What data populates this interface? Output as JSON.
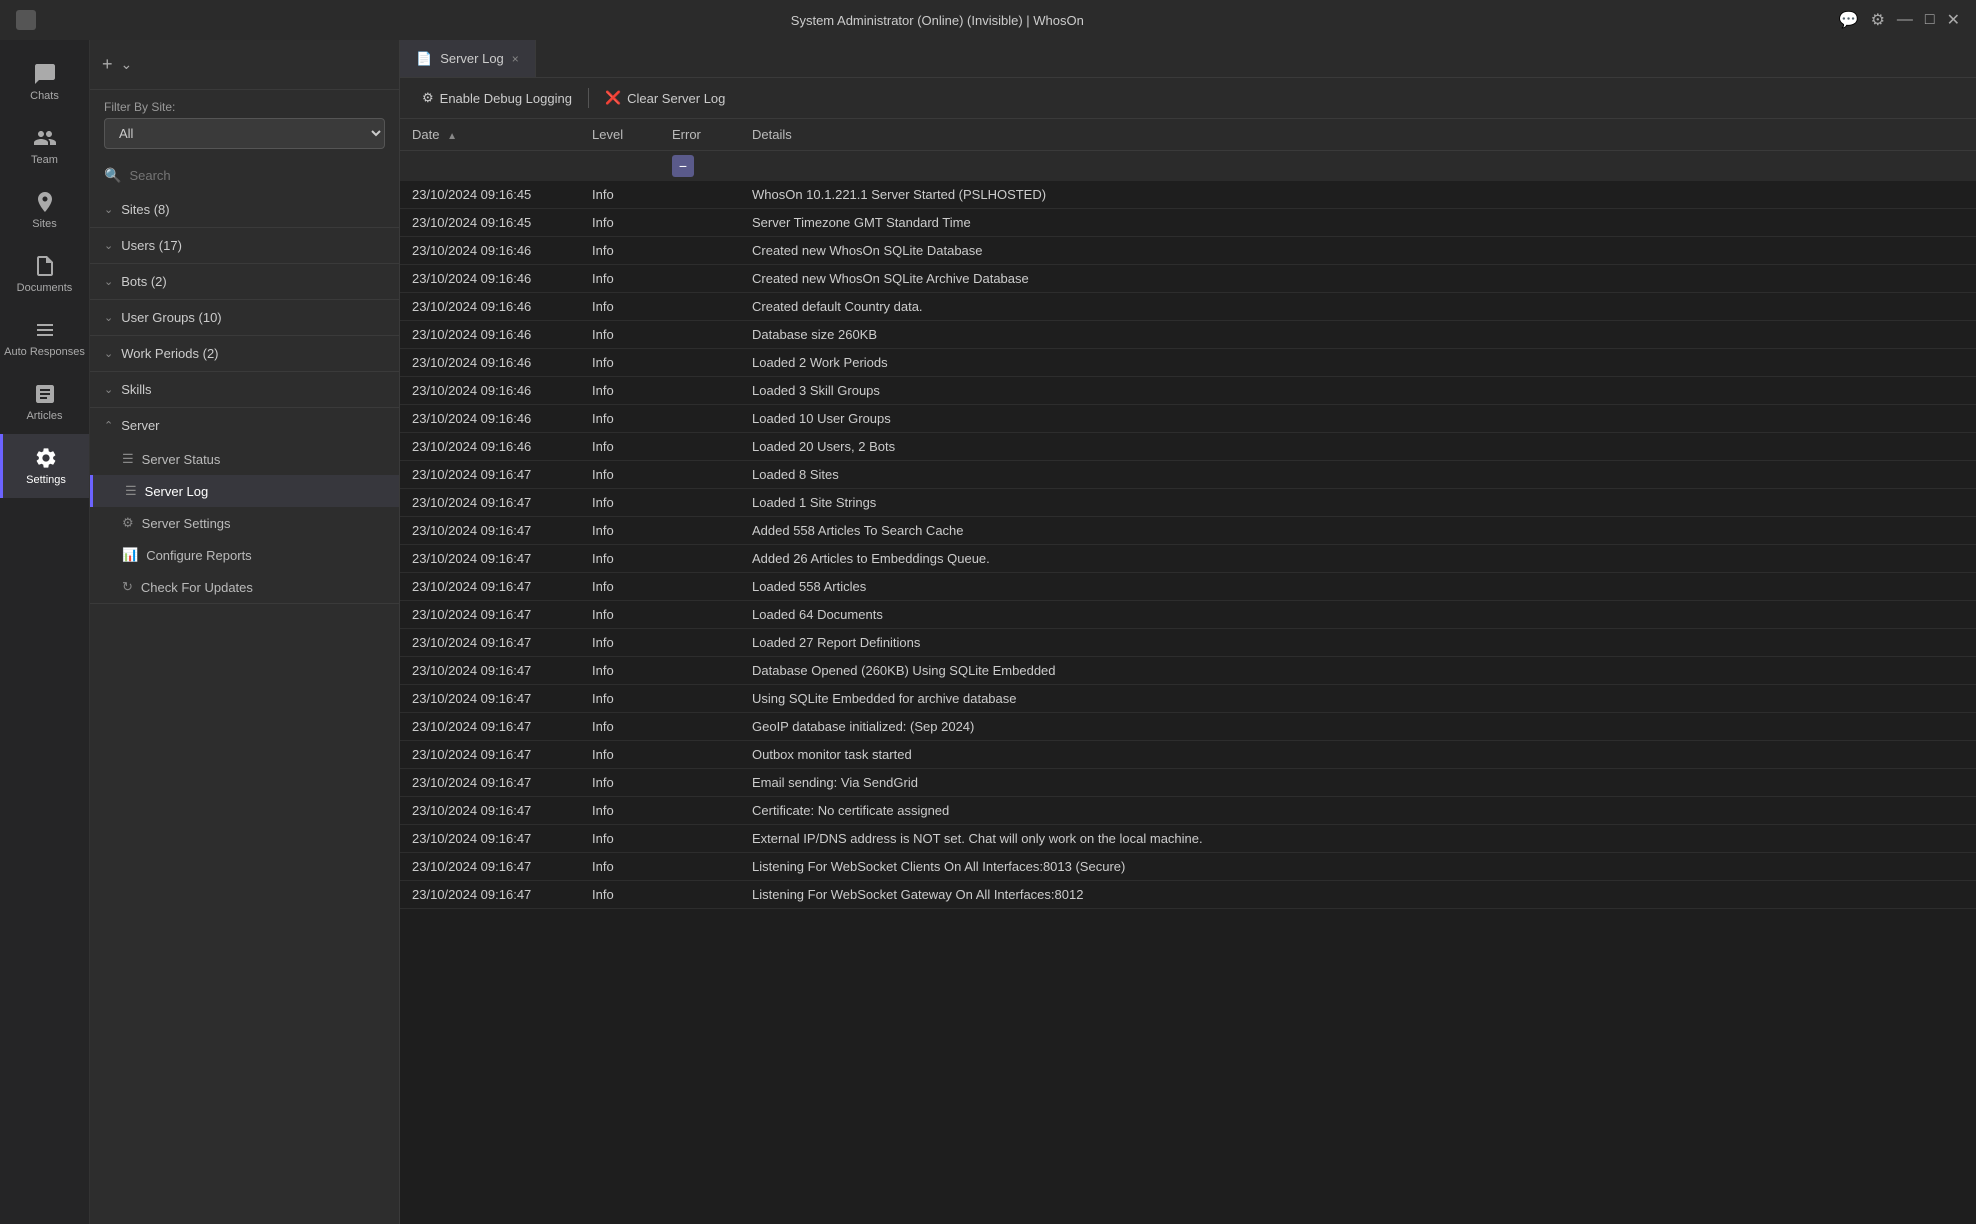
{
  "titlebar": {
    "title": "System Administrator (Online) (Invisible) | WhosOn",
    "controls": [
      "chat-icon",
      "settings-icon",
      "minimize-icon",
      "maximize-icon",
      "close-icon"
    ]
  },
  "nav": {
    "items": [
      {
        "id": "chats",
        "label": "Chats",
        "icon": "chat"
      },
      {
        "id": "team",
        "label": "Team",
        "icon": "team"
      },
      {
        "id": "sites",
        "label": "Sites",
        "icon": "sites"
      },
      {
        "id": "documents",
        "label": "Documents",
        "icon": "docs"
      },
      {
        "id": "auto-responses",
        "label": "Auto Responses",
        "icon": "auto"
      },
      {
        "id": "articles",
        "label": "Articles",
        "icon": "articles"
      },
      {
        "id": "settings",
        "label": "Settings",
        "icon": "settings",
        "active": true
      }
    ]
  },
  "sidebar": {
    "filter_label": "Filter By Site:",
    "filter_value": "All",
    "filter_options": [
      "All"
    ],
    "search_placeholder": "Search",
    "sections": [
      {
        "id": "sites",
        "label": "Sites (8)",
        "expanded": true
      },
      {
        "id": "users",
        "label": "Users (17)",
        "expanded": true
      },
      {
        "id": "bots",
        "label": "Bots (2)",
        "expanded": true
      },
      {
        "id": "user-groups",
        "label": "User Groups (10)",
        "expanded": true
      },
      {
        "id": "work-periods",
        "label": "Work Periods (2)",
        "expanded": true
      },
      {
        "id": "skills",
        "label": "Skills",
        "expanded": true
      },
      {
        "id": "server",
        "label": "Server",
        "expanded": true,
        "items": [
          {
            "id": "server-status",
            "label": "Server Status",
            "active": false
          },
          {
            "id": "server-log",
            "label": "Server Log",
            "active": true
          },
          {
            "id": "server-settings",
            "label": "Server Settings",
            "active": false
          },
          {
            "id": "configure-reports",
            "label": "Configure Reports",
            "active": false
          },
          {
            "id": "check-for-updates",
            "label": "Check For Updates",
            "active": false
          }
        ]
      }
    ]
  },
  "tab": {
    "icon": "log-icon",
    "label": "Server Log",
    "close_label": "×"
  },
  "toolbar": {
    "debug_btn": "Enable Debug Logging",
    "clear_btn": "Clear Server Log",
    "separator": "|"
  },
  "log_table": {
    "columns": [
      "Date",
      "Level",
      "Error",
      "Details"
    ],
    "rows": [
      {
        "date": "23/10/2024 09:16:45",
        "level": "Info",
        "error": "",
        "details": "WhosOn 10.1.221.1 Server Started (PSLHOSTED)"
      },
      {
        "date": "23/10/2024 09:16:45",
        "level": "Info",
        "error": "",
        "details": "Server Timezone GMT Standard Time"
      },
      {
        "date": "23/10/2024 09:16:46",
        "level": "Info",
        "error": "",
        "details": "Created new WhosOn SQLite Database"
      },
      {
        "date": "23/10/2024 09:16:46",
        "level": "Info",
        "error": "",
        "details": "Created new WhosOn SQLite Archive Database"
      },
      {
        "date": "23/10/2024 09:16:46",
        "level": "Info",
        "error": "",
        "details": "Created default Country data."
      },
      {
        "date": "23/10/2024 09:16:46",
        "level": "Info",
        "error": "",
        "details": "Database size 260KB"
      },
      {
        "date": "23/10/2024 09:16:46",
        "level": "Info",
        "error": "",
        "details": "Loaded 2 Work Periods"
      },
      {
        "date": "23/10/2024 09:16:46",
        "level": "Info",
        "error": "",
        "details": "Loaded 3 Skill Groups"
      },
      {
        "date": "23/10/2024 09:16:46",
        "level": "Info",
        "error": "",
        "details": "Loaded 10 User Groups"
      },
      {
        "date": "23/10/2024 09:16:46",
        "level": "Info",
        "error": "",
        "details": "Loaded 20 Users, 2 Bots"
      },
      {
        "date": "23/10/2024 09:16:47",
        "level": "Info",
        "error": "",
        "details": "Loaded 8 Sites"
      },
      {
        "date": "23/10/2024 09:16:47",
        "level": "Info",
        "error": "",
        "details": "Loaded 1 Site Strings"
      },
      {
        "date": "23/10/2024 09:16:47",
        "level": "Info",
        "error": "",
        "details": "Added 558 Articles To Search Cache"
      },
      {
        "date": "23/10/2024 09:16:47",
        "level": "Info",
        "error": "",
        "details": "Added 26 Articles to Embeddings Queue."
      },
      {
        "date": "23/10/2024 09:16:47",
        "level": "Info",
        "error": "",
        "details": "Loaded 558 Articles"
      },
      {
        "date": "23/10/2024 09:16:47",
        "level": "Info",
        "error": "",
        "details": "Loaded 64 Documents"
      },
      {
        "date": "23/10/2024 09:16:47",
        "level": "Info",
        "error": "",
        "details": "Loaded 27 Report Definitions"
      },
      {
        "date": "23/10/2024 09:16:47",
        "level": "Info",
        "error": "",
        "details": "Database Opened (260KB) Using SQLite Embedded"
      },
      {
        "date": "23/10/2024 09:16:47",
        "level": "Info",
        "error": "",
        "details": "Using SQLite Embedded for archive database"
      },
      {
        "date": "23/10/2024 09:16:47",
        "level": "Info",
        "error": "",
        "details": "GeoIP database initialized: (Sep 2024)"
      },
      {
        "date": "23/10/2024 09:16:47",
        "level": "Info",
        "error": "",
        "details": "Outbox monitor task started"
      },
      {
        "date": "23/10/2024 09:16:47",
        "level": "Info",
        "error": "",
        "details": "Email sending: Via SendGrid"
      },
      {
        "date": "23/10/2024 09:16:47",
        "level": "Info",
        "error": "",
        "details": "Certificate: No certificate assigned"
      },
      {
        "date": "23/10/2024 09:16:47",
        "level": "Info",
        "error": "",
        "details": "External IP/DNS address is NOT set. Chat will only work on the local machine."
      },
      {
        "date": "23/10/2024 09:16:47",
        "level": "Info",
        "error": "",
        "details": "Listening For WebSocket Clients On All Interfaces:8013 (Secure)"
      },
      {
        "date": "23/10/2024 09:16:47",
        "level": "Info",
        "error": "",
        "details": "Listening For WebSocket Gateway On All Interfaces:8012"
      }
    ]
  }
}
